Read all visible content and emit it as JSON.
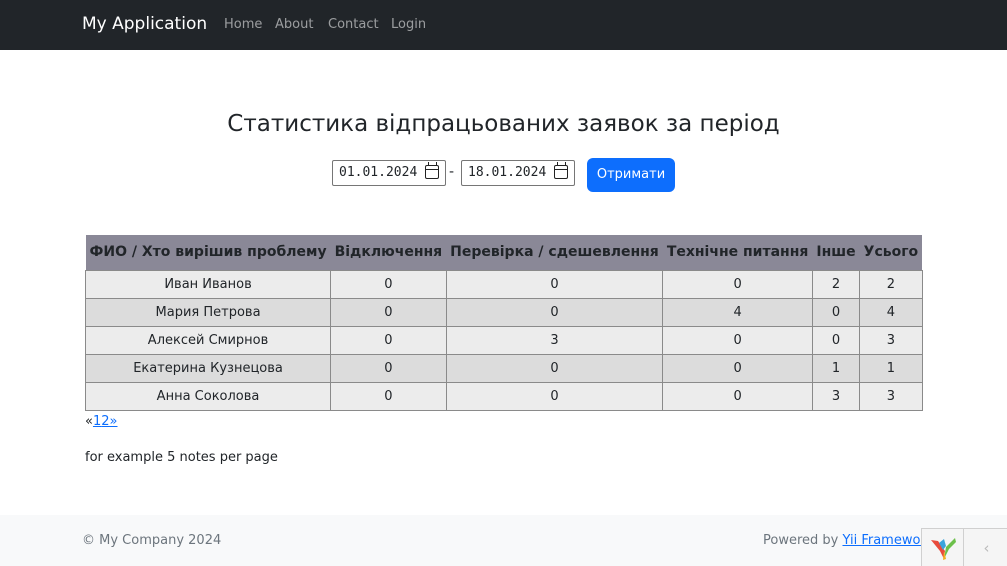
{
  "navbar": {
    "brand": "My Application",
    "links": [
      {
        "label": "Home"
      },
      {
        "label": "About"
      },
      {
        "label": "Contact"
      },
      {
        "label": "Login"
      }
    ]
  },
  "main": {
    "title": "Статистика відпрацьованих заявок за період",
    "filter": {
      "date_from": "01.01.2024",
      "separator": "-",
      "date_to": "18.01.2024",
      "submit_label": "Отримати",
      "calendar_icon": "calendar-icon"
    },
    "table": {
      "columns": [
        "ФИО / Хто вирішив проблему",
        "Відключення",
        "Перевірка / сдешевлення",
        "Технічне питання",
        "Інше",
        "Усього"
      ],
      "rows": [
        [
          "Иван Иванов",
          "0",
          "0",
          "0",
          "2",
          "2"
        ],
        [
          "Мария Петрова",
          "0",
          "0",
          "4",
          "0",
          "4"
        ],
        [
          "Алексей Смирнов",
          "0",
          "3",
          "0",
          "0",
          "3"
        ],
        [
          "Екатерина Кузнецова",
          "0",
          "0",
          "0",
          "1",
          "1"
        ],
        [
          "Анна Соколова",
          "0",
          "0",
          "0",
          "3",
          "3"
        ]
      ]
    },
    "pagination": {
      "prev": "«",
      "pages": [
        "1",
        "2"
      ],
      "next": "»"
    },
    "note": "for example 5 notes per page"
  },
  "footer": {
    "copyright": "© My Company 2024",
    "powered_prefix": "Powered by ",
    "powered_link": "Yii Framework"
  },
  "debug_toolbar": {
    "logo_icon": "yii-logo-icon",
    "toggle_icon": "chevron-left-icon",
    "toggle_glyph": "‹"
  },
  "colors": {
    "navbar_bg": "#212529",
    "primary": "#0d6efd",
    "table_header_bg": "#8a8897",
    "row_odd": "#ececec",
    "row_even": "#dcdcdc",
    "footer_bg": "#f8f9fa"
  }
}
